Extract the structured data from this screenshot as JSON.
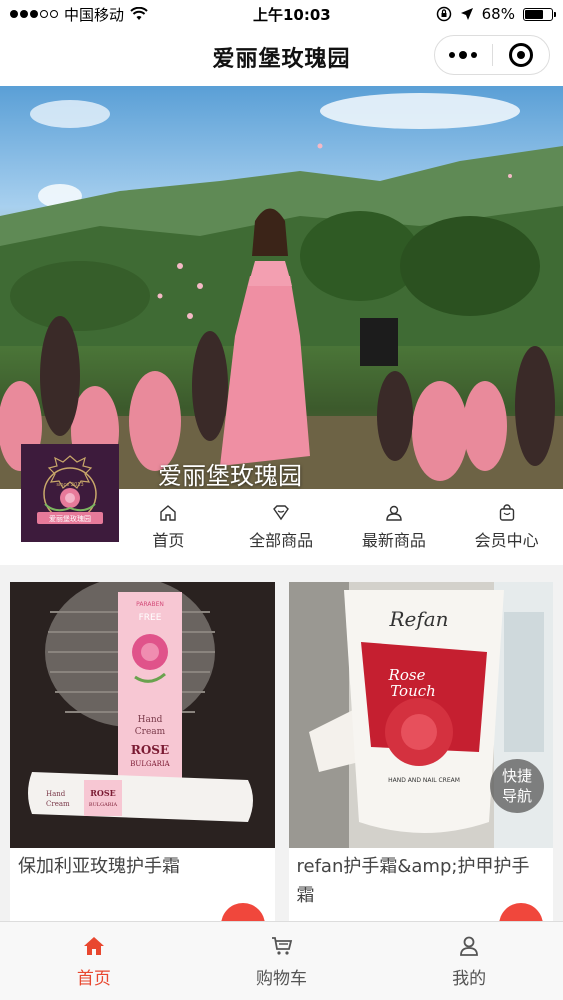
{
  "status_bar": {
    "carrier": "中国移动",
    "time": "上午10:03",
    "battery": "68%",
    "battery_level": 0.68
  },
  "nav": {
    "title": "爱丽堡玫瑰园"
  },
  "banner": {
    "title": "爱丽堡玫瑰园"
  },
  "logo": {
    "since": "since 2013",
    "ribbon": "爱丽堡玫瑰园"
  },
  "menu": [
    {
      "label": "首页",
      "icon": "home-icon"
    },
    {
      "label": "全部商品",
      "icon": "tag-icon"
    },
    {
      "label": "最新商品",
      "icon": "user-icon"
    },
    {
      "label": "会员中心",
      "icon": "bag-icon"
    }
  ],
  "products": [
    {
      "name": "保加利亚玫瑰护手霜",
      "box_text": [
        "PARABEN",
        "FREE",
        "Hand",
        "Cream",
        "ROSE",
        "BULGARIA"
      ],
      "tube_text": [
        "Hand",
        "Cream",
        "ROSE",
        "BULGARIA"
      ]
    },
    {
      "name": "refan护手霜&amp;护甲护手霜",
      "tube_text": [
        "Refan",
        "Rose",
        "Touch",
        "HAND AND NAIL CREAM"
      ]
    }
  ],
  "fab": {
    "line1": "快捷",
    "line2": "导航"
  },
  "tab_bar": [
    {
      "label": "首页",
      "icon": "home-icon",
      "active": true
    },
    {
      "label": "购物车",
      "icon": "cart-icon",
      "active": false
    },
    {
      "label": "我的",
      "icon": "profile-icon",
      "active": false
    }
  ],
  "colors": {
    "accent": "#e8472f",
    "logo_bg": "#3d1b3c"
  }
}
